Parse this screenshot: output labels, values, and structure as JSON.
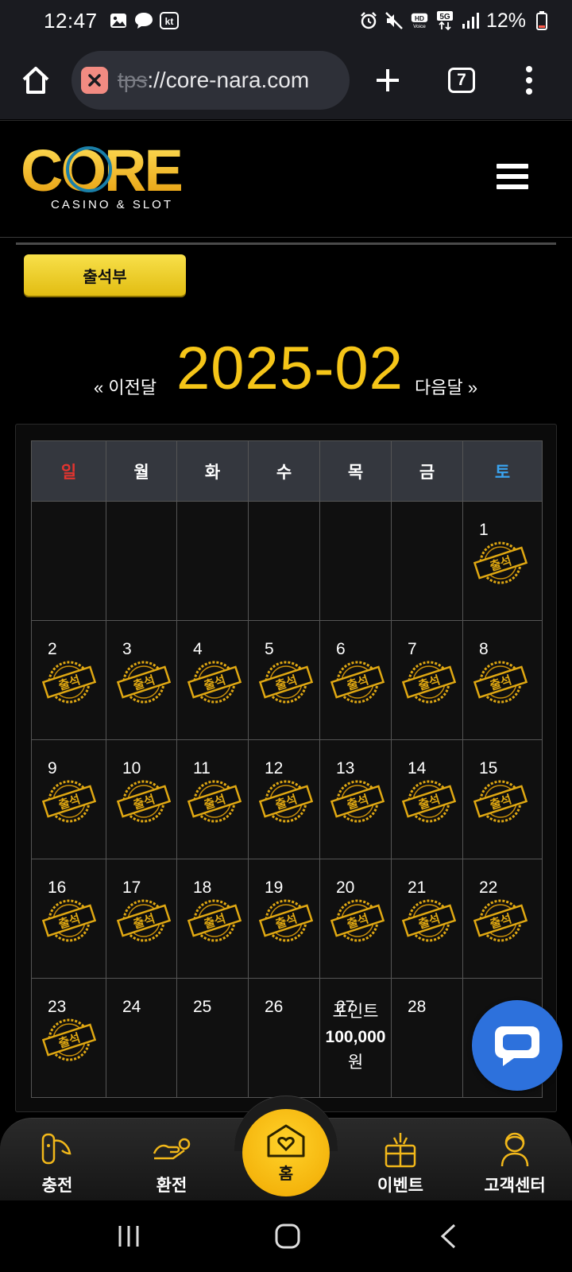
{
  "status_bar": {
    "time": "12:47",
    "left_icons": [
      "gallery-icon",
      "chat-bubble-icon",
      "kt-icon"
    ],
    "right_icons": [
      "alarm-icon",
      "mute-icon",
      "hd-voice-icon",
      "5g-icon",
      "signal-icon"
    ],
    "battery": "12%"
  },
  "browser": {
    "url_prefix_struck": "tps",
    "url_rest": "://core-nara.com",
    "tab_count": "7"
  },
  "header": {
    "logo_text": "CORE",
    "logo_sub": "CASINO & SLOT"
  },
  "attendance_tab": "출석부",
  "month_nav": {
    "prev": "« 이전달",
    "title": "2025-02",
    "next": "다음달 »"
  },
  "calendar": {
    "weekdays": [
      "일",
      "월",
      "화",
      "수",
      "목",
      "금",
      "토"
    ],
    "stamp_text": "출석",
    "weeks": [
      [
        {
          "day": ""
        },
        {
          "day": ""
        },
        {
          "day": ""
        },
        {
          "day": ""
        },
        {
          "day": ""
        },
        {
          "day": ""
        },
        {
          "day": "1",
          "stamp": true
        }
      ],
      [
        {
          "day": "2",
          "stamp": true
        },
        {
          "day": "3",
          "stamp": true
        },
        {
          "day": "4",
          "stamp": true
        },
        {
          "day": "5",
          "stamp": true
        },
        {
          "day": "6",
          "stamp": true
        },
        {
          "day": "7",
          "stamp": true
        },
        {
          "day": "8",
          "stamp": true
        }
      ],
      [
        {
          "day": "9",
          "stamp": true
        },
        {
          "day": "10",
          "stamp": true
        },
        {
          "day": "11",
          "stamp": true
        },
        {
          "day": "12",
          "stamp": true
        },
        {
          "day": "13",
          "stamp": true
        },
        {
          "day": "14",
          "stamp": true
        },
        {
          "day": "15",
          "stamp": true
        }
      ],
      [
        {
          "day": "16",
          "stamp": true
        },
        {
          "day": "17",
          "stamp": true
        },
        {
          "day": "18",
          "stamp": true
        },
        {
          "day": "19",
          "stamp": true
        },
        {
          "day": "20",
          "stamp": true
        },
        {
          "day": "21",
          "stamp": true
        },
        {
          "day": "22",
          "stamp": true
        }
      ],
      [
        {
          "day": "23",
          "stamp": true
        },
        {
          "day": "24"
        },
        {
          "day": "25"
        },
        {
          "day": "26"
        },
        {
          "day": "27",
          "points": {
            "label": "포인트",
            "amount": "100,000",
            "unit": "원"
          }
        },
        {
          "day": "28"
        },
        {
          "day": ""
        }
      ]
    ]
  },
  "bottom_nav": {
    "items": [
      {
        "label": "충전",
        "icon": "deposit-icon"
      },
      {
        "label": "환전",
        "icon": "withdraw-icon"
      },
      {
        "label": "홈",
        "icon": "home-heart-icon"
      },
      {
        "label": "이벤트",
        "icon": "gift-icon"
      },
      {
        "label": "고객센터",
        "icon": "support-icon"
      }
    ]
  },
  "colors": {
    "accent_yellow": "#f5c518",
    "sunday": "#e3342f",
    "saturday": "#3aa3ef",
    "chat_blue": "#2d71dc"
  }
}
